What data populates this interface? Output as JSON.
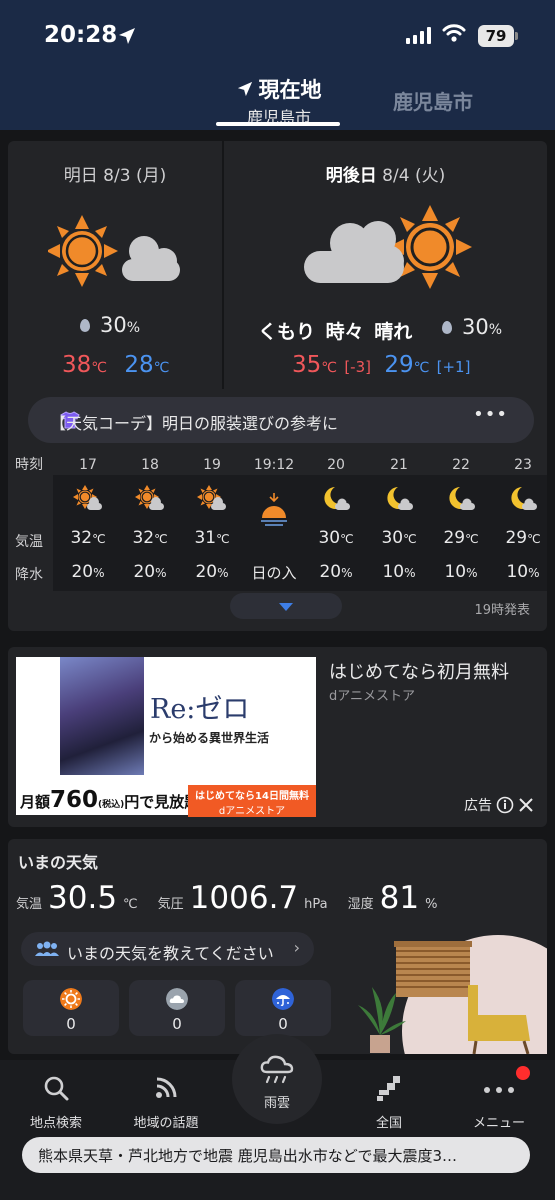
{
  "status_bar": {
    "time": "20:28",
    "battery": "79"
  },
  "header": {
    "current_tab_title": "現在地",
    "current_tab_sub": "鹿児島市",
    "other_tab": "鹿児島市"
  },
  "forecast": {
    "tomorrow": {
      "date_label": "明日 8/3 (月)",
      "rain": "30",
      "rain_unit": "%",
      "high": "38",
      "low": "28",
      "temp_unit": "℃"
    },
    "day_after": {
      "date_prefix": "明後日",
      "date_label": " 8/4 (火)",
      "weather": "くもり 時々 晴れ",
      "rain": "30",
      "rain_unit": "%",
      "high": "35",
      "high_diff": "[-3]",
      "low": "29",
      "low_diff": "[+1]",
      "temp_unit": "℃"
    },
    "coordinate_banner": "【天気コーデ】明日の服装選びの参考に",
    "coordinate_more": "•••"
  },
  "hourly": {
    "labels": {
      "time": "時刻",
      "temp": "気温",
      "rain": "降水"
    },
    "hours": [
      {
        "time": "17",
        "icon": "sun-cloud-icon",
        "temp": "32",
        "rain": "20"
      },
      {
        "time": "18",
        "icon": "sun-cloud-icon",
        "temp": "32",
        "rain": "20"
      },
      {
        "time": "19",
        "icon": "sun-cloud-icon",
        "temp": "31",
        "rain": "20"
      },
      {
        "time": "19:12",
        "icon": "sunset-icon",
        "temp": "",
        "rain": "日の入"
      },
      {
        "time": "20",
        "icon": "moon-cloud-icon",
        "temp": "30",
        "rain": "20"
      },
      {
        "time": "21",
        "icon": "moon-cloud-icon",
        "temp": "30",
        "rain": "10"
      },
      {
        "time": "22",
        "icon": "moon-cloud-icon",
        "temp": "29",
        "rain": "10"
      },
      {
        "time": "23",
        "icon": "moon-cloud-icon",
        "temp": "29",
        "rain": "10"
      }
    ],
    "temp_unit": "℃",
    "rain_unit": "%",
    "issued": "19時発表"
  },
  "ad": {
    "title": "Re:ゼロ",
    "subtitle": "から始める異世界生活",
    "price_prefix": "月額",
    "price": "760",
    "price_suffix": "円で見放題!",
    "price_tax": "(税込)",
    "cta1": "はじめてなら14日間無料",
    "cta2": "dアニメストア",
    "headline": "はじめてなら初月無料",
    "source": "dアニメストア",
    "label": "広告"
  },
  "now": {
    "title": "いまの天気",
    "temp_label": "気温",
    "temp": "30.5",
    "temp_unit": "℃",
    "pressure_label": "気圧",
    "pressure": "1006.7",
    "pressure_unit": "hPa",
    "humidity_label": "湿度",
    "humidity": "81",
    "humidity_unit": "%",
    "ask": "いまの天気を教えてください",
    "reports": [
      {
        "icon": "sunny-icon",
        "count": "0"
      },
      {
        "icon": "cloudy-icon",
        "count": "0"
      },
      {
        "icon": "rainy-icon",
        "count": "0"
      }
    ]
  },
  "nav": {
    "search": "地点検索",
    "topics": "地域の話題",
    "rain": "雨雲",
    "national": "全国",
    "menu": "メニュー"
  },
  "ticker": "熊本県天草・芦北地方で地震 鹿児島出水市などで最大震度3…",
  "colors": {
    "high": "#f0575a",
    "low": "#4b93f0",
    "header_bg": "#1b2a46",
    "sun": "#f08a2a"
  }
}
